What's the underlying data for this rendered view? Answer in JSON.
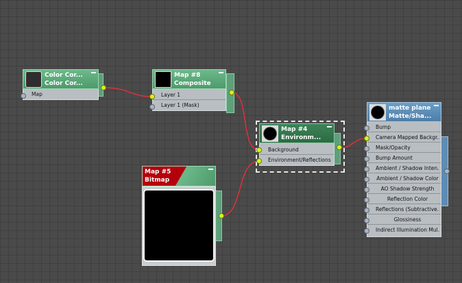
{
  "nodes": {
    "color_correction": {
      "title1": "Color Cor...",
      "title2": "Color Cor...",
      "slots": [
        "Map"
      ]
    },
    "map8": {
      "title1": "Map #8",
      "title2": "Composite",
      "slots": [
        "Layer 1",
        "Layer 1 (Mask)"
      ]
    },
    "map4": {
      "title1": "Map #4",
      "title2": "Environm...",
      "slots": [
        "Background",
        "Environment/Reflections"
      ]
    },
    "map5": {
      "title1": "Map #5",
      "title2": "Bitmap"
    },
    "matte": {
      "title1": "matte plane",
      "title2": "Matte/Sha...",
      "slots": [
        "Bump",
        "Camera Mapped Backgr...",
        "Mask/Opacity",
        "Bump Amount",
        "Ambient / Shadow Inten...",
        "Ambient / Shadow Color",
        "AO Shadow Strength",
        "Reflection Color",
        "Reflections (Subtractive...",
        "Glossiness",
        "Indirect Illumination Mul..."
      ]
    }
  },
  "colors": {
    "wire": "#e0303a",
    "socket_active": "#d6f51e",
    "background": "#4a4a4a"
  }
}
